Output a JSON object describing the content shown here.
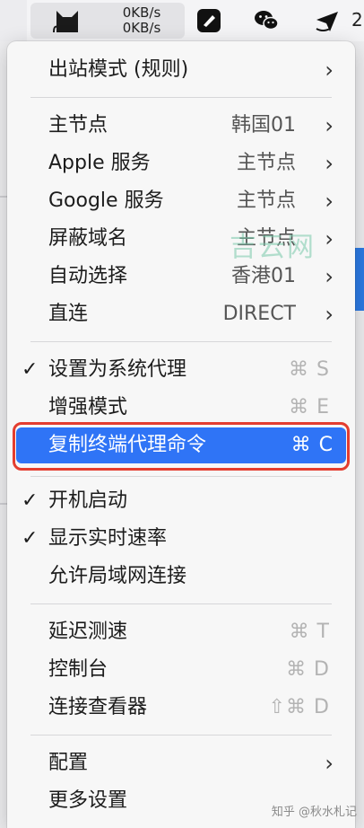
{
  "menubar": {
    "upload_speed": "0KB/s",
    "download_speed": "0KB/s",
    "right_partial_text": "2",
    "icons": [
      "clashx-cat-icon",
      "dropbox-icon",
      "wechat-icon",
      "paper-plane-icon"
    ]
  },
  "menu": {
    "outbound_mode": {
      "label": "出站模式 (规则)"
    },
    "proxy_groups": [
      {
        "label": "主节点",
        "value": "韩国01"
      },
      {
        "label": "Apple 服务",
        "value": "主节点"
      },
      {
        "label": "Google 服务",
        "value": "主节点"
      },
      {
        "label": "屏蔽域名",
        "value": "主节点"
      },
      {
        "label": "自动选择",
        "value": "香港01"
      },
      {
        "label": "直连",
        "value": "DIRECT"
      }
    ],
    "system_proxy": {
      "label": "设置为系统代理",
      "shortcut": "⌘ S",
      "checked": true
    },
    "enhanced_mode": {
      "label": "增强模式",
      "shortcut": "⌘ E"
    },
    "copy_terminal": {
      "label": "复制终端代理命令",
      "shortcut": "⌘ C"
    },
    "start_at_login": {
      "label": "开机启动",
      "checked": true
    },
    "show_speed": {
      "label": "显示实时速率",
      "checked": true
    },
    "allow_lan": {
      "label": "允许局域网连接"
    },
    "latency_test": {
      "label": "延迟测速",
      "shortcut": "⌘ T"
    },
    "dashboard": {
      "label": "控制台",
      "shortcut": "⌘ D"
    },
    "conn_viewer": {
      "label": "连接查看器",
      "shortcut": "⇧⌘ D"
    },
    "config": {
      "label": "配置"
    },
    "more_settings": {
      "label": "更多设置"
    }
  },
  "watermark": "吉云网",
  "footer_watermark": "知乎 @秋水札记",
  "colors": {
    "highlight": "#2f74f6",
    "annotation": "#e43d2f"
  }
}
